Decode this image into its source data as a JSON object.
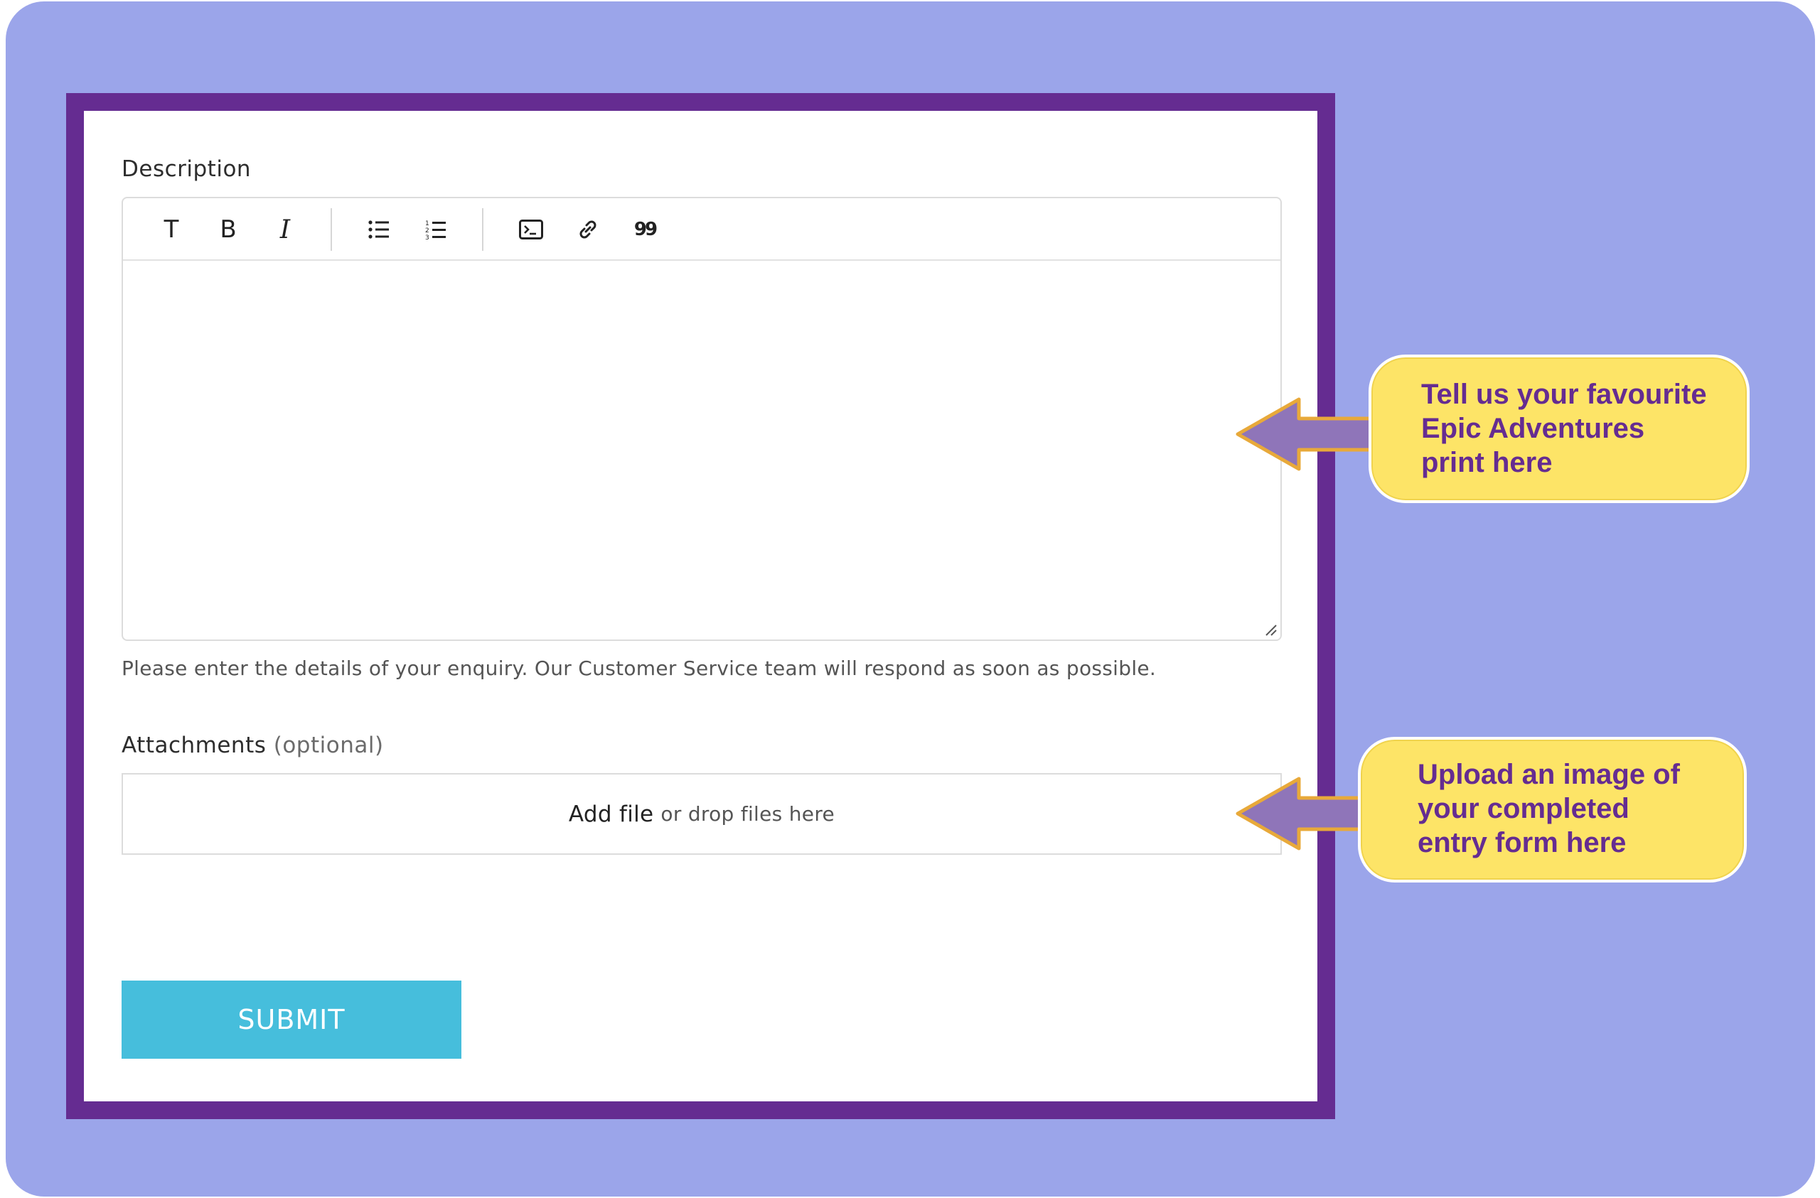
{
  "form": {
    "description_label": "Description",
    "toolbar": {
      "text_label": "T",
      "bold_label": "B",
      "italic_label": "I",
      "quote_label": "99"
    },
    "description_hint": "Please enter the details of your enquiry. Our Customer Service team will respond as soon as possible.",
    "attachments_label": "Attachments",
    "attachments_optional": "(optional)",
    "add_file_label": "Add file",
    "drop_label": "or drop files here",
    "submit_label": "SUBMIT"
  },
  "callouts": [
    {
      "lines": [
        "Tell us your favourite",
        "Epic Adventures",
        "print here"
      ]
    },
    {
      "lines": [
        "Upload an image of",
        "your completed",
        "entry form here"
      ]
    }
  ],
  "colors": {
    "background": "#9ba5ea",
    "frame": "#652c91",
    "submit": "#46bedc",
    "callout_fill": "#fde467",
    "callout_text": "#652c91",
    "arrow_fill": "#8f75b9",
    "arrow_outline": "#e8a93a"
  },
  "icons": [
    "text-format-icon",
    "bold-icon",
    "italic-icon",
    "bullet-list-icon",
    "numbered-list-icon",
    "code-block-icon",
    "link-icon",
    "quote-icon"
  ]
}
